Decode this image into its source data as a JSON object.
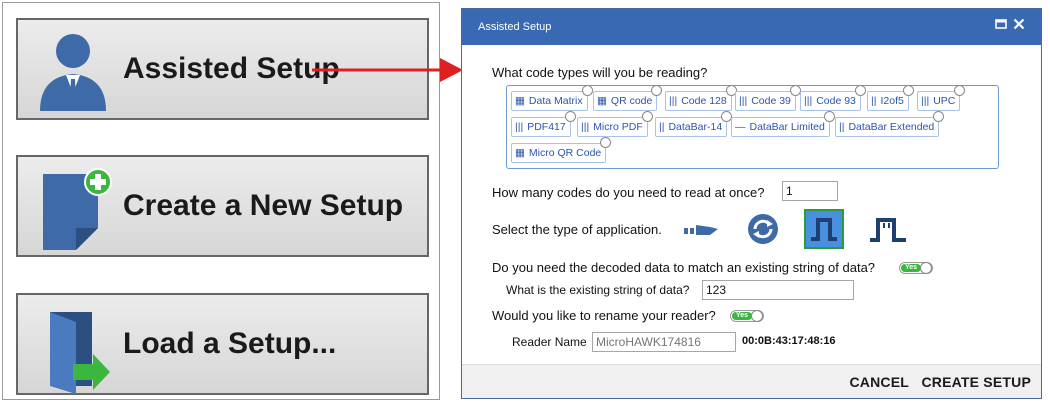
{
  "left_panel": {
    "buttons": [
      {
        "label": "Assisted Setup",
        "icon": "user-icon"
      },
      {
        "label": "Create a New Setup",
        "icon": "new-document-icon"
      },
      {
        "label": "Load a Setup...",
        "icon": "open-folder-icon"
      }
    ]
  },
  "colors": {
    "accent": "#3a69b3",
    "arrow": "#e02020",
    "toggle_on": "#3bb73f"
  },
  "dialog": {
    "title": "Assisted Setup",
    "q_code_types": "What code types will you be reading?",
    "code_types": [
      "Data Matrix",
      "QR code",
      "Code 128",
      "Code 39",
      "Code 93",
      "I2of5",
      "UPC",
      "PDF417",
      "Micro PDF",
      "DataBar-14",
      "DataBar Limited",
      "DataBar Extended",
      "Micro QR Code"
    ],
    "q_count": "How many codes do you need to read at once?",
    "count_value": "1",
    "q_app_type": "Select the type of application.",
    "app_types": [
      "conveyor-icon",
      "continuous-icon",
      "triggered-pulse-icon",
      "external-trigger-icon"
    ],
    "q_match": "Do you need the decoded data to match an existing string of data?",
    "match_toggle": "Yes",
    "q_existing": "What is the existing string of data?",
    "existing_value": "123",
    "q_rename": "Would you like to rename your reader?",
    "rename_toggle": "Yes",
    "reader_name_label": "Reader Name",
    "reader_name_placeholder": "MicroHAWK174816",
    "mac_address": "00:0B:43:17:48:16",
    "cancel_label": "CANCEL",
    "create_label": "CREATE SETUP"
  }
}
